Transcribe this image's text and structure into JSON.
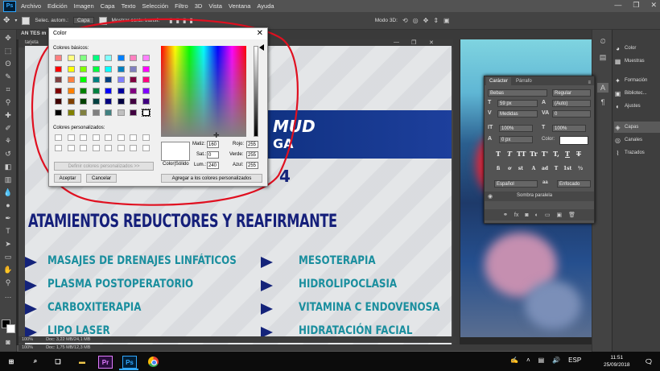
{
  "menu": [
    "Archivo",
    "Edición",
    "Imagen",
    "Capa",
    "Texto",
    "Selección",
    "Filtro",
    "3D",
    "Vista",
    "Ventana",
    "Ayuda"
  ],
  "ps_logo": "Ps",
  "options": {
    "auto_select_label": "Selec. autom.:",
    "auto_select_value": "Capa",
    "transform_label": "Mostrar contr. transf.",
    "mode_3d_label": "Modo 3D:"
  },
  "document": {
    "tab_title": "AN TES m",
    "second_doc_title": "tarjeta",
    "zoom": "100%",
    "doc_size": "Doc: 3,22 MB/24,1 MB",
    "zoom2": "100%",
    "doc_size2": "Doc: 1,75 MB/12,3 MB"
  },
  "artwork": {
    "banner_line1": "MUD",
    "banner_line2": "GA",
    "number": "4",
    "headline": "ATAMIENTOS REDUCTORES Y REAFIRMANTE",
    "services_left": [
      "MASAJES DE DRENAJES LINFÁTICOS",
      "PLASMA POSTOPERATORIO",
      "CARBOXITERAPIA",
      "LIPO LASER"
    ],
    "services_right": [
      "MESOTERAPIA",
      "HIDROLIPOCLASIA",
      "VITAMINA C ENDOVENOSA",
      "HIDRATACIÓN FACIAL"
    ],
    "accent_color": "#151f7a",
    "teal_color": "#1a8e9e"
  },
  "color_dialog": {
    "title": "Color",
    "basic_label": "Colores básicos:",
    "custom_label": "Colores personalizados:",
    "define_button": "Definir colores personalizados >>",
    "ok_button": "Aceptar",
    "cancel_button": "Cancelar",
    "add_button": "Agregar a los colores personalizados",
    "solid_label": "Color|Sólido",
    "fields": {
      "matiz_label": "Matiz:",
      "matiz": "160",
      "sat_label": "Sat.:",
      "sat": "0",
      "lum_label": "Lum.:",
      "lum": "240",
      "rojo_label": "Rojo:",
      "rojo": "255",
      "verde_label": "Verde:",
      "verde": "255",
      "azul_label": "Azul:",
      "azul": "255"
    },
    "basic_colors": [
      "#ff8080",
      "#ffff80",
      "#80ff80",
      "#00ff80",
      "#80ffff",
      "#0080ff",
      "#ff80c0",
      "#ff80ff",
      "#ff0000",
      "#ffff00",
      "#80ff00",
      "#00ff40",
      "#00ffff",
      "#0080c0",
      "#8080c0",
      "#ff00ff",
      "#804040",
      "#ff8040",
      "#00ff00",
      "#008080",
      "#004080",
      "#8080ff",
      "#800040",
      "#ff0080",
      "#800000",
      "#ff8000",
      "#008000",
      "#008040",
      "#0000ff",
      "#0000a0",
      "#800080",
      "#8000ff",
      "#400000",
      "#804000",
      "#004000",
      "#004040",
      "#000080",
      "#000040",
      "#400040",
      "#400080",
      "#000000",
      "#808000",
      "#808040",
      "#808080",
      "#408080",
      "#c0c0c0",
      "#400040",
      "#ffffff"
    ]
  },
  "char_panel": {
    "tab1": "Carácter",
    "tab2": "Párrafo",
    "font": "Bebas",
    "style": "Regular",
    "size": "59 px",
    "leading": "(Auto)",
    "kerning": "Medidas",
    "tracking": "0",
    "vscale": "100%",
    "hscale": "100%",
    "baseline": "0 px",
    "color_label": "Color:",
    "language": "Español",
    "antialias": "Enfocado",
    "layer_effect": "Sombra paralela",
    "style_buttons": [
      "T",
      "T",
      "TT",
      "Tr",
      "T'",
      "T,",
      "T",
      "T"
    ],
    "opentype_buttons": [
      "fi",
      "ơ",
      "st",
      "A",
      "ad",
      "T",
      "1st",
      "½"
    ]
  },
  "right_panel": {
    "items": [
      "Color",
      "Muestras",
      "Formación",
      "Bibliotec...",
      "Ajustes",
      "Capas",
      "Canales",
      "Trazados"
    ]
  },
  "taskbar": {
    "time": "11:51",
    "date": "25/09/2018",
    "lang": "ESP"
  }
}
